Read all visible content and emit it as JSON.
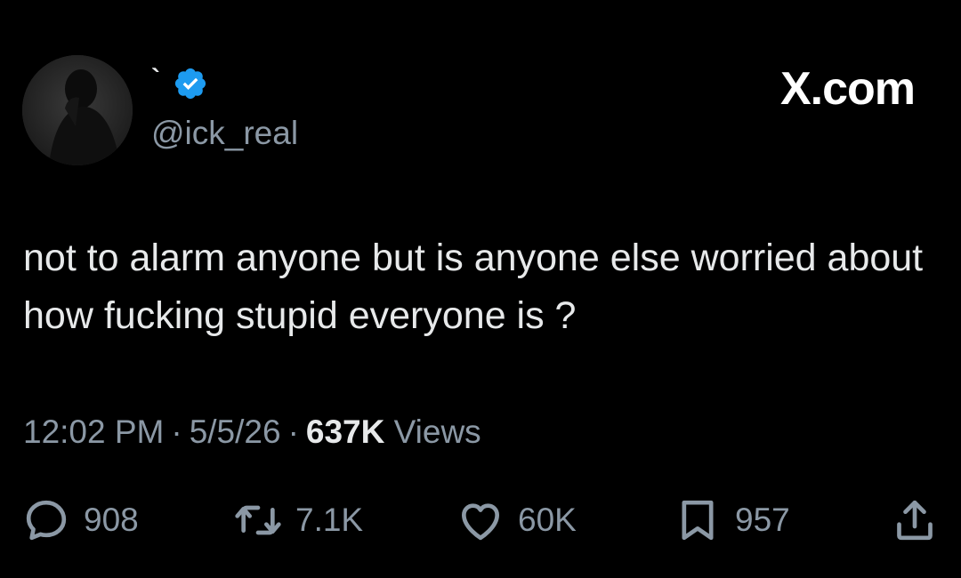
{
  "author": {
    "display_name": "`",
    "handle": "@ick_real",
    "verified": true
  },
  "brand": {
    "label": "X.com"
  },
  "tweet": {
    "text": "not to alarm anyone but is anyone else worried about how fucking stupid everyone is ?",
    "time": "12:02 PM",
    "date": "5/5/26",
    "views_count": "637K",
    "views_label": "Views",
    "separator": "·"
  },
  "actions": {
    "reply_icon": "reply-icon",
    "reply_count": "908",
    "repost_icon": "repost-icon",
    "repost_count": "7.1K",
    "like_icon": "heart-icon",
    "like_count": "60K",
    "bookmark_icon": "bookmark-icon",
    "bookmark_count": "957",
    "share_icon": "share-icon"
  },
  "colors": {
    "background": "#000000",
    "text_primary": "#e7e9ea",
    "text_secondary": "#8b98a5",
    "verified_blue": "#1d9bf0"
  }
}
